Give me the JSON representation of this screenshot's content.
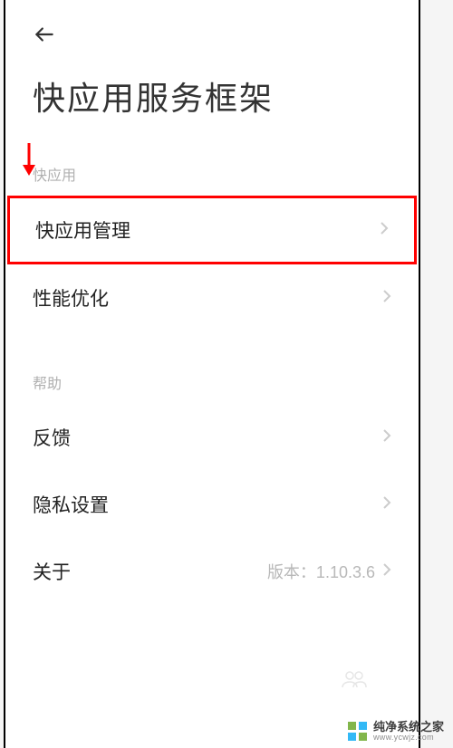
{
  "header": {
    "title": "快应用服务框架"
  },
  "sections": {
    "quickapp": {
      "header": "快应用",
      "items": [
        {
          "label": "快应用管理"
        },
        {
          "label": "性能优化"
        }
      ]
    },
    "help": {
      "header": "帮助",
      "items": [
        {
          "label": "反馈"
        },
        {
          "label": "隐私设置"
        },
        {
          "label": "关于",
          "value": "版本：1.10.3.6"
        }
      ]
    }
  },
  "watermark": {
    "name": "纯净系统之家",
    "url": "www.ycwjz.com"
  }
}
